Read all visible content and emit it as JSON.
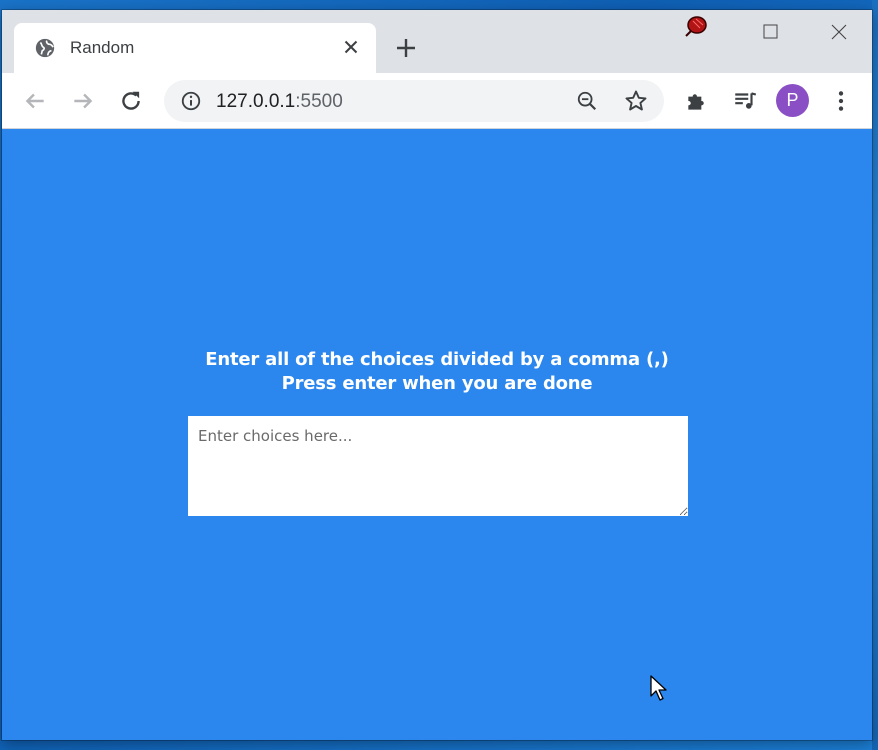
{
  "browser": {
    "tab_title": "Random",
    "url_host": "127.0.0.1",
    "url_port": ":5500",
    "profile_initial": "P"
  },
  "page": {
    "instruction_line1": "Enter all of the choices divided by a comma (,)",
    "instruction_line2": "Press enter when you are done",
    "textarea_placeholder": "Enter choices here...",
    "textarea_value": ""
  },
  "colors": {
    "page_background": "#2b87ed",
    "avatar": "#8a4fc4",
    "tab_strip": "#dee1e6"
  },
  "icons": {
    "tab_favicon": "globe-icon",
    "tab_close": "close-icon",
    "new_tab": "plus-icon",
    "back": "arrow-left-icon",
    "forward": "arrow-right-icon",
    "reload": "reload-icon",
    "site_info": "info-icon",
    "zoom": "zoom-out-icon",
    "bookmark": "star-icon",
    "extensions": "puzzle-icon",
    "media": "media-queue-icon",
    "menu": "kebab-menu-icon"
  }
}
